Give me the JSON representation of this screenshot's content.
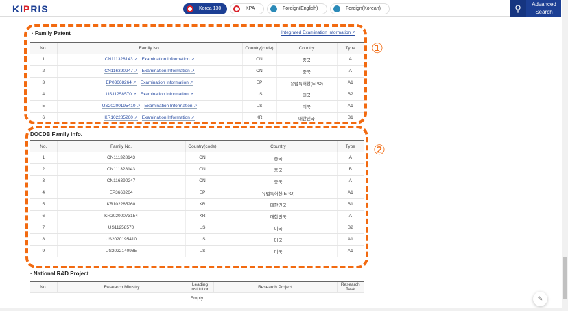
{
  "header": {
    "logo": "KIPRIS",
    "tabs": [
      {
        "label": "Korea",
        "count": "130"
      },
      {
        "label": "KPA"
      },
      {
        "label": "Foreign(English)"
      },
      {
        "label": "Foreign(Korean)"
      }
    ],
    "advanced_search": "Advanced Search"
  },
  "family_patent": {
    "title": "Family Patent",
    "integrated_link": "Integrated Examination Information",
    "exam_label": "Examination Information",
    "headers": [
      "No.",
      "Family No.",
      "Country(code)",
      "Country",
      "Type"
    ],
    "rows": [
      [
        "1",
        "CN111328143",
        "CN",
        "중국",
        "A"
      ],
      [
        "2",
        "CN116390247",
        "CN",
        "중국",
        "A"
      ],
      [
        "3",
        "EP03668264",
        "EP",
        "유럽특허청(EPO)",
        "A1"
      ],
      [
        "4",
        "US11258570",
        "US",
        "미국",
        "B2"
      ],
      [
        "5",
        "US20200195410",
        "US",
        "미국",
        "A1"
      ],
      [
        "6",
        "KR102285260",
        "KR",
        "대한민국",
        "B1"
      ]
    ]
  },
  "docdb": {
    "title": "DOCDB Family info.",
    "headers": [
      "No.",
      "Family No.",
      "Country(code)",
      "Country",
      "Type"
    ],
    "rows": [
      [
        "1",
        "CN111328143",
        "CN",
        "중국",
        "A"
      ],
      [
        "2",
        "CN111328143",
        "CN",
        "중국",
        "B"
      ],
      [
        "3",
        "CN116390247",
        "CN",
        "중국",
        "A"
      ],
      [
        "4",
        "EP3668264",
        "EP",
        "유럽특허청(EPO)",
        "A1"
      ],
      [
        "5",
        "KR102285260",
        "KR",
        "대한민국",
        "B1"
      ],
      [
        "6",
        "KR20200073154",
        "KR",
        "대한민국",
        "A"
      ],
      [
        "7",
        "US11258570",
        "US",
        "미국",
        "B2"
      ],
      [
        "8",
        "US2020195410",
        "US",
        "미국",
        "A1"
      ],
      [
        "9",
        "US2022140985",
        "US",
        "미국",
        "A1"
      ]
    ]
  },
  "national": {
    "title": "National R&D Project",
    "headers": [
      "No.",
      "Research Ministry",
      "Leading Institution",
      "Research Project",
      "Research Task"
    ],
    "empty": "Empty"
  },
  "annotations": [
    "①",
    "②"
  ],
  "colors": {
    "brand": "#1c3f94",
    "annotation": "#f26a10"
  }
}
